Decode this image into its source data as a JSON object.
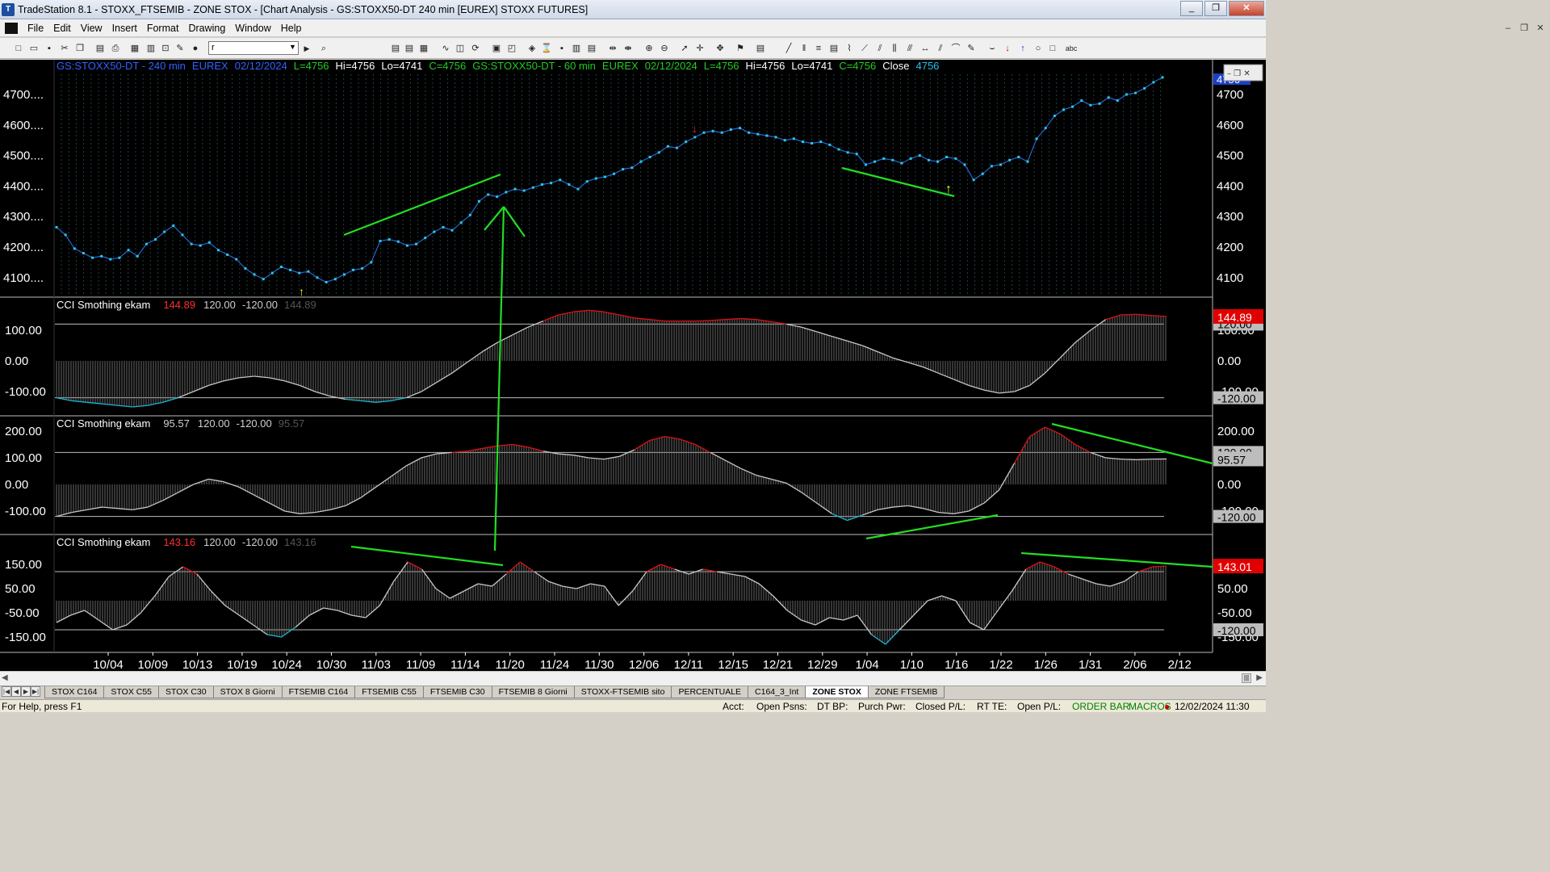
{
  "window": {
    "title": "TradeStation 8.1 - STOXX_FTSEMIB - ZONE STOX - [Chart Analysis - GS:STOXX50-DT  240 min  [EUREX] STOXX FUTURES]",
    "min_label": "_",
    "max_label": "❐",
    "close_label": "✕"
  },
  "menu": [
    "File",
    "Edit",
    "View",
    "Insert",
    "Format",
    "Drawing",
    "Window",
    "Help"
  ],
  "mdi_controls": [
    "–",
    "❐",
    "✕"
  ],
  "toolbar": {
    "symbol_value": "r"
  },
  "chart": {
    "header_line1": [
      {
        "text": "GS:STOXX50-DT - 240 min",
        "color": "#2f63ff"
      },
      {
        "text": "EUREX",
        "color": "#2f63ff"
      },
      {
        "text": "02/12/2024",
        "color": "#2f63ff"
      },
      {
        "text": "L=4756",
        "color": "#22cc22"
      },
      {
        "text": "Hi=4756",
        "color": "#ffffff"
      },
      {
        "text": "Lo=4741",
        "color": "#ffffff"
      },
      {
        "text": "C=4756",
        "color": "#22cc22"
      },
      {
        "text": "GS:STOXX50-DT - 60 min",
        "color": "#22cc22"
      },
      {
        "text": "EUREX",
        "color": "#22cc22"
      },
      {
        "text": "02/12/2024",
        "color": "#22cc22"
      },
      {
        "text": "L=4756",
        "color": "#22cc22"
      },
      {
        "text": "Hi=4756",
        "color": "#ffffff"
      },
      {
        "text": "Lo=4741",
        "color": "#ffffff"
      },
      {
        "text": "C=4756",
        "color": "#22cc22"
      },
      {
        "text": "Close",
        "color": "#ffffff"
      },
      {
        "text": "4756",
        "color": "#22c0ee"
      }
    ],
    "price_axis": [
      "4700....",
      "4600....",
      "4500....",
      "4400....",
      "4300....",
      "4200....",
      "4100...."
    ],
    "price_axis_right": [
      "4700",
      "4600",
      "4500",
      "4400",
      "4300",
      "4200",
      "4100"
    ],
    "price_axis_right_partial": "4756",
    "dates": [
      "10/04",
      "10/09",
      "10/13",
      "10/19",
      "10/24",
      "10/30",
      "11/03",
      "11/09",
      "11/14",
      "11/20",
      "11/24",
      "11/30",
      "12/06",
      "12/11",
      "12/15",
      "12/21",
      "12/29",
      "1/04",
      "1/10",
      "1/16",
      "1/22",
      "1/26",
      "1/31",
      "2/06",
      "2/12"
    ],
    "panes": [
      {
        "title": "CCI Smothing ekam",
        "value": "144.89",
        "value_color": "#ff3030",
        "upper": "120.00",
        "lower": "-120.00",
        "ghost": "144.89",
        "axis": [
          "100.00",
          "0.00",
          "-100.00"
        ],
        "right_badge": "144.89",
        "right_badge_bg": "#e00000",
        "right_band_upper": "120.00",
        "right_band_lower": "-120.00"
      },
      {
        "title": "CCI Smothing ekam",
        "value": "95.57",
        "value_color": "#d0d0d0",
        "upper": "120.00",
        "lower": "-120.00",
        "ghost": "95.57",
        "axis": [
          "200.00",
          "100.00",
          "0.00",
          "-100.00"
        ],
        "right_badge": "95.57",
        "right_badge_bg": "#bdbdbd",
        "right_band_upper": "120.00",
        "right_band_lower": "-120.00"
      },
      {
        "title": "CCI Smothing ekam",
        "value": "143.16",
        "value_color": "#ff3030",
        "upper": "120.00",
        "lower": "-120.00",
        "ghost": "143.16",
        "axis": [
          "150.00",
          "50.00",
          "-50.00",
          "-150.00"
        ],
        "right_badge": "143.01",
        "right_badge_bg": "#e00000",
        "right_band_upper": "",
        "right_band_lower": "-120.00"
      }
    ],
    "colors": {
      "price": "#29c5f0",
      "cci_mid": "#c8c8c8",
      "cci_high": "#e01010",
      "cci_low": "#1cb8d8",
      "trendline": "#22dd22",
      "grid": "#ffffff"
    }
  },
  "sheet_tabs": [
    "STOX C164",
    "STOX C55",
    "STOX  C30",
    "STOX  8 Giorni",
    "FTSEMIB C164",
    "FTSEMIB C55",
    "FTSEMIB C30",
    "FTSEMIB  8 Giorni",
    "STOXX-FTSEMIB sito",
    "PERCENTUALE",
    "C164_3_Int",
    "ZONE STOX",
    "ZONE FTSEMIB"
  ],
  "active_tab": "ZONE STOX",
  "status": {
    "help": "For Help, press F1",
    "acct": "Acct:",
    "open_psns": "Open Psns:",
    "dt_bp": "DT BP:",
    "purch_pwr": "Purch Pwr:",
    "closed_pl": "Closed P/L:",
    "rt_te": "RT TE:",
    "open_pl": "Open P/L:",
    "order_bar": "ORDER BAR",
    "macros": "MACROS",
    "datetime": "12/02/2024 11:30"
  }
}
